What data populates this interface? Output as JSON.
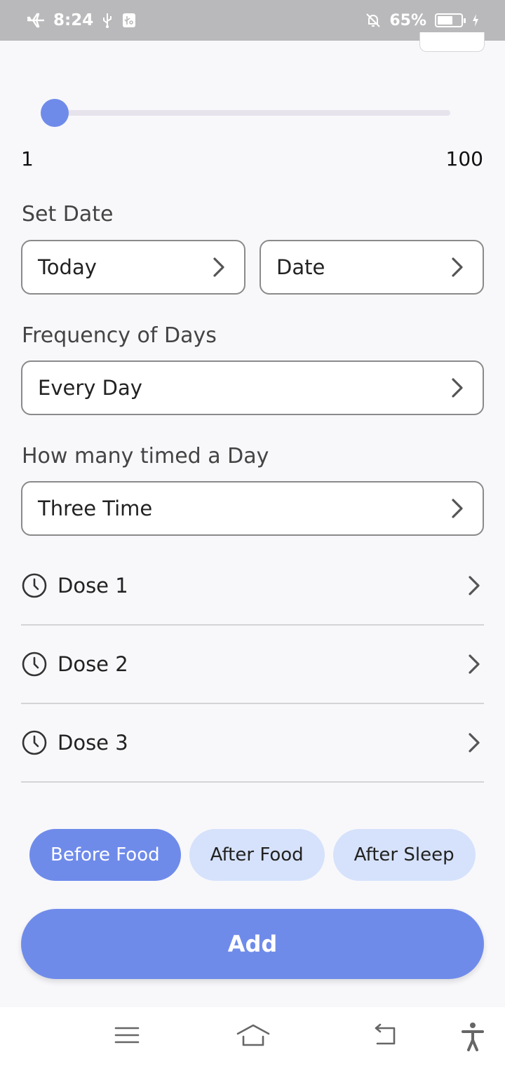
{
  "status_bar": {
    "time": "8:24",
    "battery_percent": "65%",
    "battery_level": 0.65,
    "icons": [
      "airplane-icon",
      "usb-icon",
      "usb-debug-icon",
      "alarm-off-icon",
      "battery-icon",
      "charging-icon"
    ]
  },
  "slider": {
    "min_label": "1",
    "max_label": "100",
    "value_fraction": 0.0,
    "accent": "#6f8bea"
  },
  "set_date": {
    "label": "Set Date",
    "start_value": "Today",
    "date_value": "Date"
  },
  "frequency": {
    "label": "Frequency of Days",
    "value": "Every Day"
  },
  "times_per_day": {
    "label": "How many timed a Day",
    "value": "Three Time"
  },
  "doses": [
    {
      "label": "Dose 1"
    },
    {
      "label": "Dose 2"
    },
    {
      "label": "Dose 3"
    }
  ],
  "food_options": [
    {
      "label": "Before Food",
      "selected": true
    },
    {
      "label": "After Food",
      "selected": false
    },
    {
      "label": "After Sleep",
      "selected": false
    }
  ],
  "add_button": {
    "label": "Add"
  },
  "nav_bar": {
    "icons": [
      "menu-icon",
      "home-icon",
      "back-icon",
      "accessibility-icon"
    ]
  }
}
